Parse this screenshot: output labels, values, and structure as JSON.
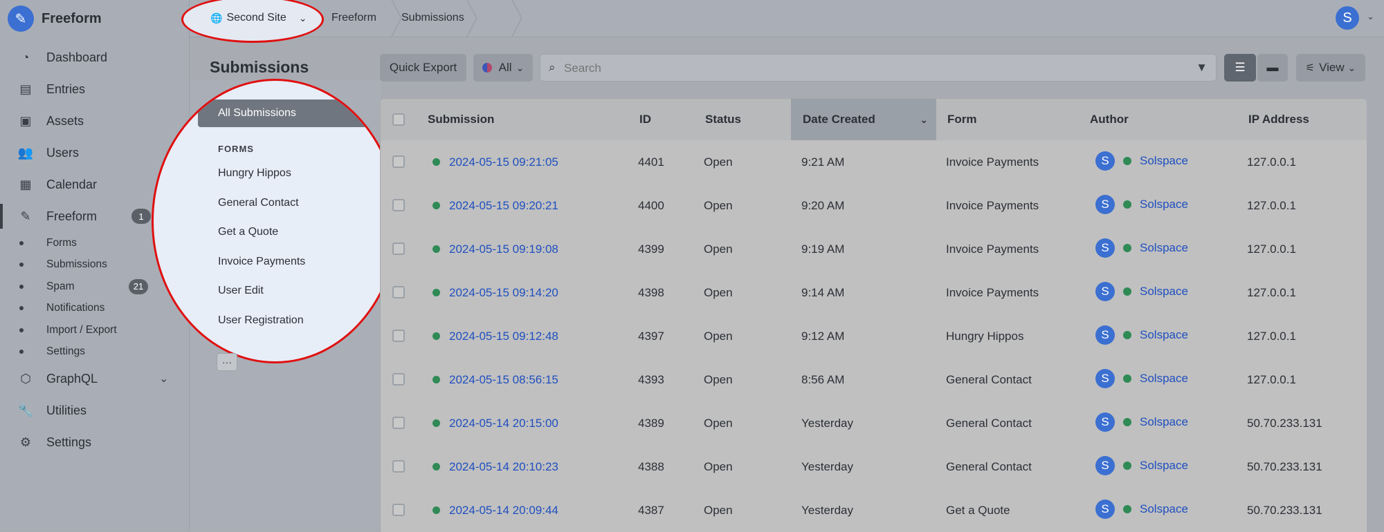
{
  "app": {
    "name": "Freeform",
    "logo_icon": "freeform-logo-icon"
  },
  "sidebar": {
    "items": [
      {
        "label": "Dashboard",
        "icon": "dashboard-icon"
      },
      {
        "label": "Entries",
        "icon": "entries-icon"
      },
      {
        "label": "Assets",
        "icon": "assets-icon"
      },
      {
        "label": "Users",
        "icon": "users-icon"
      },
      {
        "label": "Calendar",
        "icon": "calendar-icon"
      },
      {
        "label": "Freeform",
        "icon": "freeform-icon",
        "badge": "1"
      },
      {
        "label": "GraphQL",
        "icon": "graphql-icon"
      },
      {
        "label": "Utilities",
        "icon": "wrench-icon"
      },
      {
        "label": "Settings",
        "icon": "gear-icon"
      }
    ],
    "freeform_sub": [
      {
        "label": "Forms"
      },
      {
        "label": "Submissions"
      },
      {
        "label": "Spam",
        "badge": "21"
      },
      {
        "label": "Notifications"
      },
      {
        "label": "Import / Export"
      },
      {
        "label": "Settings"
      }
    ]
  },
  "topbar": {
    "site": "Second Site",
    "crumbs": [
      "Freeform",
      "Submissions"
    ],
    "user_initial": "S"
  },
  "page": {
    "title": "Submissions",
    "quick_export": "Quick Export",
    "status_filter": "All",
    "search_placeholder": "Search",
    "view_label": "View"
  },
  "sources": {
    "all_label": "All Submissions",
    "forms_heading": "FORMS",
    "forms": [
      "Hungry Hippos",
      "General Contact",
      "Get a Quote",
      "Invoice Payments",
      "User Edit",
      "User Registration"
    ],
    "more_label": "···"
  },
  "table": {
    "headers": {
      "submission": "Submission",
      "id": "ID",
      "status": "Status",
      "date_created": "Date Created",
      "form": "Form",
      "author": "Author",
      "ip": "IP Address"
    },
    "rows": [
      {
        "submission": "2024-05-15 09:21:05",
        "id": "4401",
        "status": "Open",
        "date": "9:21 AM",
        "form": "Invoice Payments",
        "author_initial": "S",
        "author": "Solspace",
        "ip": "127.0.0.1"
      },
      {
        "submission": "2024-05-15 09:20:21",
        "id": "4400",
        "status": "Open",
        "date": "9:20 AM",
        "form": "Invoice Payments",
        "author_initial": "S",
        "author": "Solspace",
        "ip": "127.0.0.1"
      },
      {
        "submission": "2024-05-15 09:19:08",
        "id": "4399",
        "status": "Open",
        "date": "9:19 AM",
        "form": "Invoice Payments",
        "author_initial": "S",
        "author": "Solspace",
        "ip": "127.0.0.1"
      },
      {
        "submission": "2024-05-15 09:14:20",
        "id": "4398",
        "status": "Open",
        "date": "9:14 AM",
        "form": "Invoice Payments",
        "author_initial": "S",
        "author": "Solspace",
        "ip": "127.0.0.1"
      },
      {
        "submission": "2024-05-15 09:12:48",
        "id": "4397",
        "status": "Open",
        "date": "9:12 AM",
        "form": "Hungry Hippos",
        "author_initial": "S",
        "author": "Solspace",
        "ip": "127.0.0.1"
      },
      {
        "submission": "2024-05-15 08:56:15",
        "id": "4393",
        "status": "Open",
        "date": "8:56 AM",
        "form": "General Contact",
        "author_initial": "S",
        "author": "Solspace",
        "ip": "127.0.0.1"
      },
      {
        "submission": "2024-05-14 20:15:00",
        "id": "4389",
        "status": "Open",
        "date": "Yesterday",
        "form": "General Contact",
        "author_initial": "S",
        "author": "Solspace",
        "ip": "50.70.233.131"
      },
      {
        "submission": "2024-05-14 20:10:23",
        "id": "4388",
        "status": "Open",
        "date": "Yesterday",
        "form": "General Contact",
        "author_initial": "S",
        "author": "Solspace",
        "ip": "50.70.233.131"
      },
      {
        "submission": "2024-05-14 20:09:44",
        "id": "4387",
        "status": "Open",
        "date": "Yesterday",
        "form": "Get a Quote",
        "author_initial": "S",
        "author": "Solspace",
        "ip": "50.70.233.131"
      }
    ]
  },
  "colors": {
    "accent": "#3b6fd1",
    "link": "#1f4fbf",
    "status_open": "#2f8a55",
    "annotation": "#e01010"
  }
}
